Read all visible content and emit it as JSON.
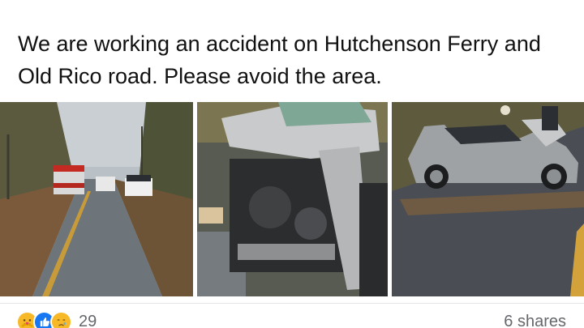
{
  "post": {
    "text": "We are working an accident on Hutchenson Ferry and Old Rico road. Please avoid the area."
  },
  "photos": [
    {
      "icon": "road-scene-photo"
    },
    {
      "icon": "wrecked-engine-photo"
    },
    {
      "icon": "damaged-car-photo"
    }
  ],
  "reactions": {
    "icons": [
      "care-reaction-icon",
      "like-reaction-icon",
      "sad-reaction-icon"
    ],
    "count": "29"
  },
  "shares": {
    "label": "6 shares"
  },
  "colors": {
    "like": "#1877f2",
    "emoji": "#f7b928",
    "meta_text": "#65676b"
  }
}
